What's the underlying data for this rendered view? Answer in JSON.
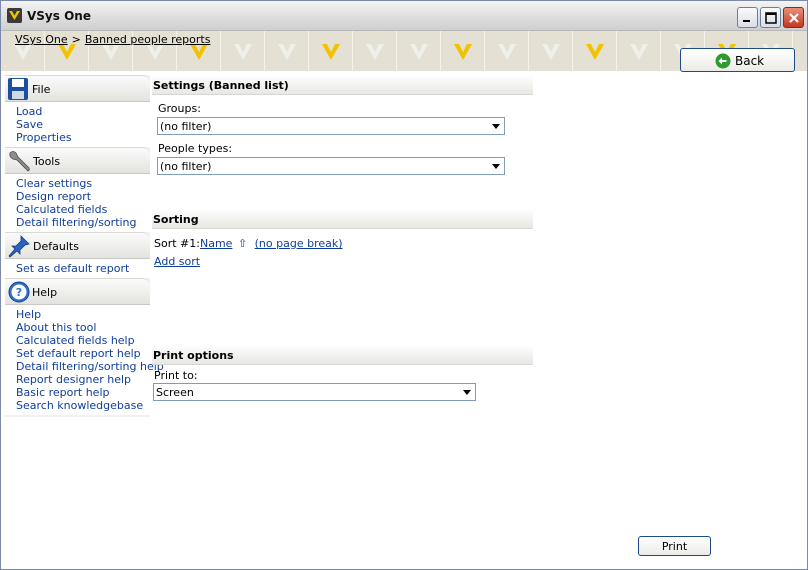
{
  "window": {
    "title": "VSys One"
  },
  "breadcrumb": {
    "root": "VSys One",
    "separator": ">",
    "current": "Banned people reports"
  },
  "back_button": {
    "label": "Back"
  },
  "sidebar": {
    "file": {
      "title": "File",
      "items": [
        "Load",
        "Save",
        "Properties"
      ]
    },
    "tools": {
      "title": "Tools",
      "items": [
        "Clear settings",
        "Design report",
        "Calculated fields",
        "Detail filtering/sorting"
      ]
    },
    "defaults": {
      "title": "Defaults",
      "items": [
        "Set as default report"
      ]
    },
    "help": {
      "title": "Help",
      "items": [
        "Help",
        "About this tool",
        "Calculated fields help",
        "Set default report help",
        "Detail filtering/sorting help",
        "Report designer help",
        "Basic report help",
        "Search knowledgebase"
      ]
    }
  },
  "settings": {
    "heading": "Settings (Banned list)",
    "groups_label": "Groups:",
    "groups_value": "(no filter)",
    "people_types_label": "People types:",
    "people_types_value": "(no filter)"
  },
  "sorting": {
    "heading": "Sorting",
    "sort1_prefix": "Sort #1:",
    "sort1_field": "Name",
    "sort1_direction_icon": "up-arrow-icon",
    "sort1_direction_glyph": "⇧",
    "sort1_break": "(no page break)",
    "add_sort": "Add sort"
  },
  "print_options": {
    "heading": "Print options",
    "print_to_label": "Print to:",
    "print_to_value": "Screen"
  },
  "print_button": {
    "label": "Print"
  },
  "colors": {
    "link": "#0f3e9a",
    "close_button": "#c4381f",
    "banner": "#ece8dc",
    "chevron": "#f2c200"
  }
}
